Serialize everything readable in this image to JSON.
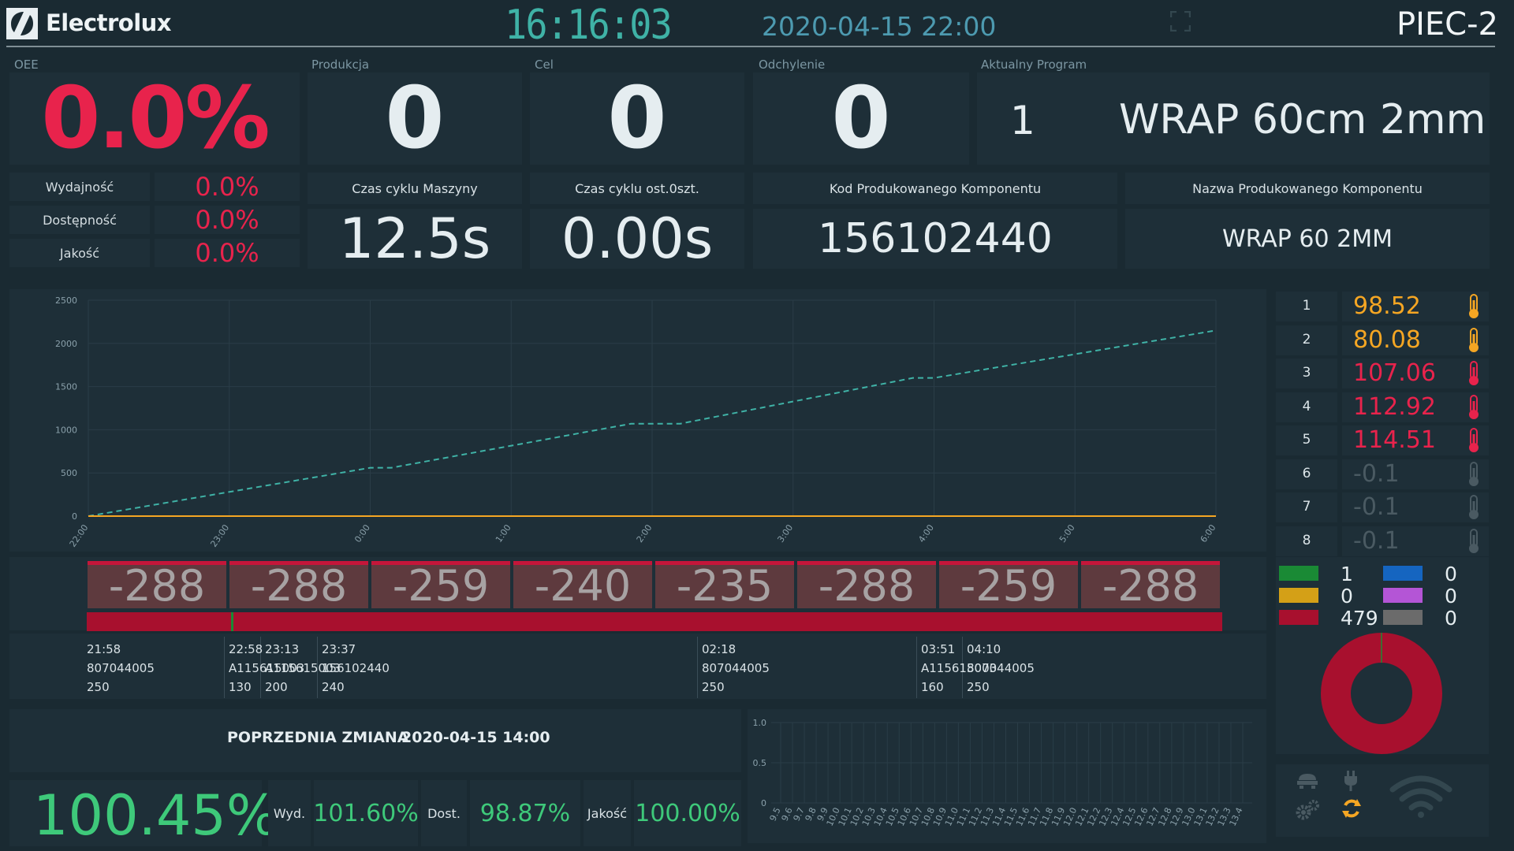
{
  "header": {
    "brand": "Electrolux",
    "clock": "16:16:03",
    "shift_start": "2020-04-15 22:00",
    "station": "PIEC-2"
  },
  "kpi": {
    "oee_label": "OEE",
    "oee_value": "0.0%",
    "production_label": "Produkcja",
    "production_value": "0",
    "target_label": "Cel",
    "target_value": "0",
    "deviation_label": "Odchylenie",
    "deviation_value": "0",
    "program_label": "Aktualny Program",
    "program_number": "1",
    "program_name": "WRAP 60cm 2mm"
  },
  "oee_breakdown": [
    {
      "label": "Wydajność",
      "value": "0.0%"
    },
    {
      "label": "Dostępność",
      "value": "0.0%"
    },
    {
      "label": "Jakość",
      "value": "0.0%"
    }
  ],
  "cycle": {
    "machine_label": "Czas cyklu Maszyny",
    "machine_value": "12.5s",
    "last_label": "Czas cyklu ost.0szt.",
    "last_value": "0.00s",
    "code_label": "Kod Produkowanego Komponentu",
    "code_value": "156102440",
    "name_label": "Nazwa Produkowanego Komponentu",
    "name_value": "WRAP 60 2MM"
  },
  "chart_data": {
    "type": "line",
    "x": [
      "22:00",
      "23:00",
      "0:00",
      "1:00",
      "2:00",
      "3:00",
      "4:00",
      "5:00",
      "6:00"
    ],
    "ytick_labels": [
      "0",
      "500",
      "1000",
      "1500",
      "2000",
      "2500"
    ],
    "ylim": [
      0,
      2500
    ],
    "series": [
      {
        "color": "#3fb2a6",
        "style": "dashed",
        "points": [
          [
            0,
            0
          ],
          [
            2,
            560
          ],
          [
            2.15,
            560
          ],
          [
            3.85,
            1070
          ],
          [
            4.2,
            1070
          ],
          [
            5.85,
            1600
          ],
          [
            6,
            1600
          ],
          [
            8,
            2150
          ]
        ]
      },
      {
        "color": "#f5a623",
        "style": "solid",
        "points": [
          [
            0,
            0
          ],
          [
            8,
            0
          ]
        ]
      }
    ]
  },
  "temperatures": [
    {
      "index": "1",
      "value": "98.52",
      "level": "orange"
    },
    {
      "index": "2",
      "value": "80.08",
      "level": "orange"
    },
    {
      "index": "3",
      "value": "107.06",
      "level": "red"
    },
    {
      "index": "4",
      "value": "112.92",
      "level": "red"
    },
    {
      "index": "5",
      "value": "114.51",
      "level": "red"
    },
    {
      "index": "6",
      "value": "-0.1",
      "level": "off"
    },
    {
      "index": "7",
      "value": "-0.1",
      "level": "off"
    },
    {
      "index": "8",
      "value": "-0.1",
      "level": "off"
    }
  ],
  "deviations": [
    "-288",
    "-288",
    "-259",
    "-240",
    "-235",
    "-288",
    "-259",
    "-288"
  ],
  "orders": [
    {
      "time": "21:58",
      "code": "807044005",
      "qty": "250"
    },
    {
      "time": "22:58",
      "code": "A115615003",
      "qty": "130"
    },
    {
      "time": "23:13",
      "code": "A115615003",
      "qty": "200"
    },
    {
      "time": "23:37",
      "code": "156102440",
      "qty": "240"
    },
    {
      "time": "02:18",
      "code": "807044005",
      "qty": "250"
    },
    {
      "time": "03:51",
      "code": "A115615003",
      "qty": "160"
    },
    {
      "time": "04:10",
      "code": "807044005",
      "qty": "250"
    }
  ],
  "status_legend": [
    {
      "color": "#1a8a35",
      "count": "1"
    },
    {
      "color": "#d4a017",
      "count": "0"
    },
    {
      "color": "#a8102e",
      "count": "479"
    },
    {
      "color": "#1565c0",
      "count": "0"
    },
    {
      "color": "#b455d6",
      "count": "0"
    },
    {
      "color": "#6b6b6b",
      "count": "0"
    }
  ],
  "previous_shift": {
    "title": "POPRZEDNIA ZMIANA",
    "date": "2020-04-15 14:00",
    "oee": "100.45%",
    "perf_label": "Wyd.",
    "perf_value": "101.60%",
    "avail_label": "Dost.",
    "avail_value": "98.87%",
    "quality_label": "Jakość",
    "quality_value": "100.00%"
  },
  "mini_chart": {
    "ytick_labels": [
      "1.0",
      "0.5",
      "0"
    ],
    "x_labels": [
      "9.5",
      "9.6",
      "9.7",
      "9.8",
      "9.9",
      "10.0",
      "10.1",
      "10.2",
      "10.3",
      "10.4",
      "10.5",
      "10.6",
      "10.7",
      "10.8",
      "10.9",
      "11.0",
      "11.1",
      "11.2",
      "11.3",
      "11.4",
      "11.5",
      "11.6",
      "11.7",
      "11.8",
      "11.9",
      "12.0",
      "12.1",
      "12.2",
      "12.3",
      "12.4",
      "12.5",
      "12.6",
      "12.7",
      "12.8",
      "12.9",
      "13.0",
      "13.1",
      "13.2",
      "13.3",
      "13.4"
    ]
  },
  "icons": [
    "expand-icon",
    "thermometer-icon",
    "machine-icon",
    "plug-icon",
    "gears-icon",
    "sync-icon",
    "wifi-icon"
  ]
}
